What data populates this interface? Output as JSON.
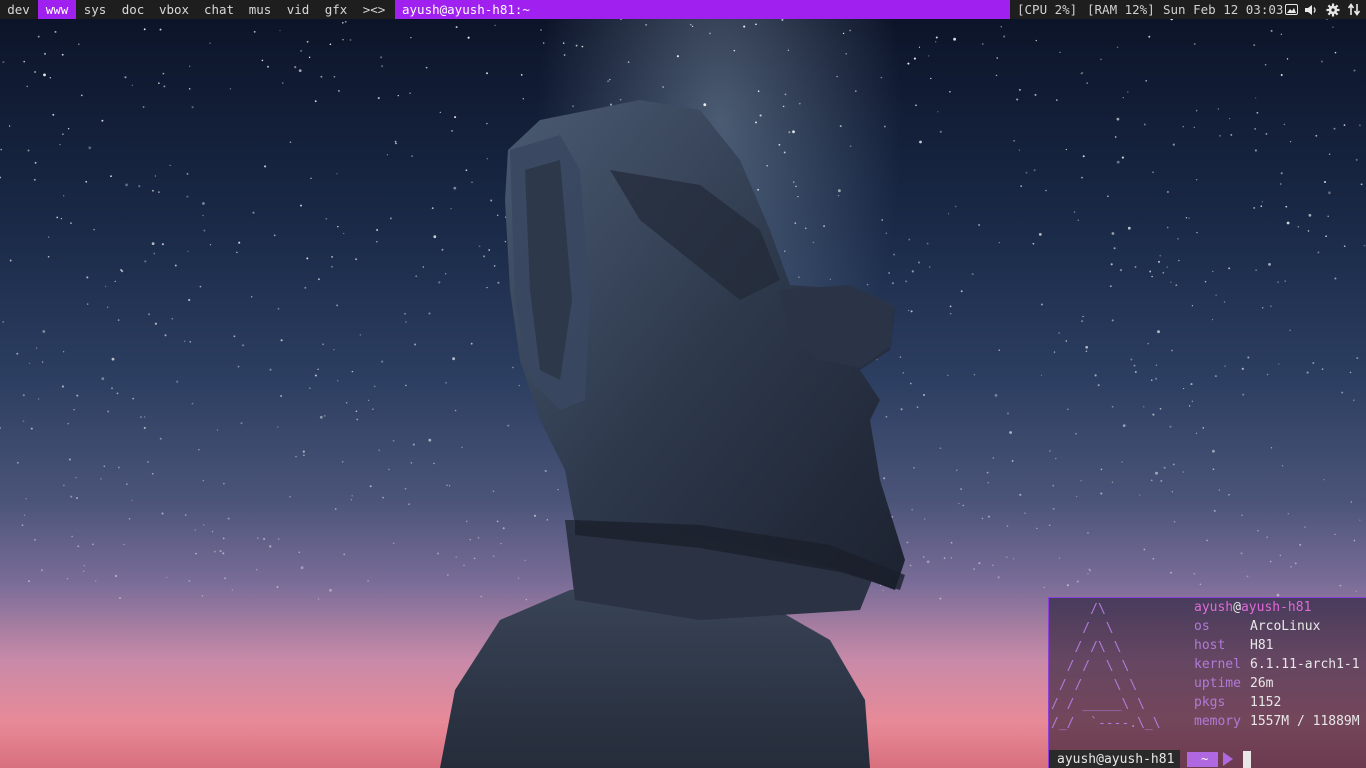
{
  "topbar": {
    "workspaces": [
      {
        "label": "dev",
        "active": false
      },
      {
        "label": "www",
        "active": true
      },
      {
        "label": "sys",
        "active": false
      },
      {
        "label": "doc",
        "active": false
      },
      {
        "label": "vbox",
        "active": false
      },
      {
        "label": "chat",
        "active": false
      },
      {
        "label": "mus",
        "active": false
      },
      {
        "label": "vid",
        "active": false
      },
      {
        "label": "gfx",
        "active": false
      }
    ],
    "layout_indicator": "><>",
    "window_title": "ayush@ayush-h81:~",
    "cpu": "[CPU 2%]",
    "ram": "[RAM 12%]",
    "clock": "Sun Feb 12 03:03",
    "tray_icons": [
      "image-icon",
      "volume-icon",
      "gear-icon",
      "network-arrows-icon"
    ]
  },
  "colors": {
    "accent": "#a020f0",
    "bar_bg": "#1e1e1e",
    "neofetch_key": "#b07ad8",
    "neofetch_user": "#e06ad8"
  },
  "terminal": {
    "ascii_art": "     /\\\n    /  \\\n   / /\\ \\\n  / /  \\ \\\n / /    \\ \\\n/ / _____\\ \\\n/_/  `----.\\_\\",
    "user": "ayush",
    "at": "@",
    "host": "ayush-h81",
    "fields": [
      {
        "key": "os",
        "value": "ArcoLinux"
      },
      {
        "key": "host",
        "value": "H81"
      },
      {
        "key": "kernel",
        "value": "6.1.11-arch1-1"
      },
      {
        "key": "uptime",
        "value": "26m"
      },
      {
        "key": "pkgs",
        "value": "1152"
      },
      {
        "key": "memory",
        "value": "1557M / 11889M"
      }
    ],
    "prompt_user": "ayush@ayush-h81",
    "prompt_dir": "~"
  }
}
